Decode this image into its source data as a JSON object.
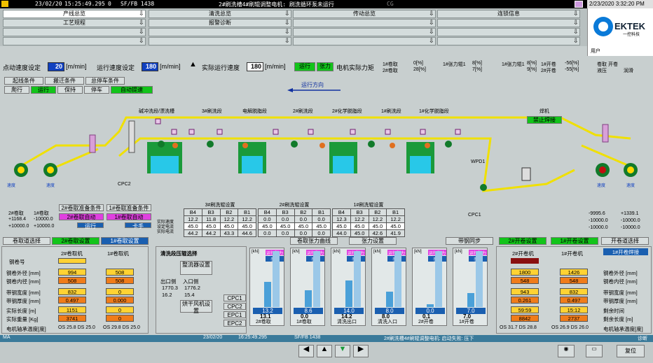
{
  "topbar": {
    "date": "23/02/20",
    "time": "15:25:49.295",
    "code": "0",
    "sf": "SF/FB 1438",
    "message": "2#刷洗槽4#刷辊调整电机: 刷洗循环泵未运行",
    "cg": "CG"
  },
  "clock": "2/23/2020 3:32:20 PM",
  "user": "用户",
  "logo": {
    "name": "EKTEK",
    "sub": "一控科技"
  },
  "menu": [
    [
      "产线总览",
      "清洗总览",
      "传动总览",
      "连锁信息"
    ],
    [
      "工艺规程",
      "报警诊断",
      "",
      ""
    ],
    [
      "",
      "",
      "",
      ""
    ],
    [
      "",
      "",
      "",
      ""
    ]
  ],
  "speed": {
    "set_label": "点动速度设定",
    "set_value": "20",
    "unit": "[m/min]",
    "run_label": "运行速度设定",
    "run_value": "180",
    "act_label": "实际运行速度",
    "act_value": "180",
    "run_btn": "运行",
    "tension_btn": "张力"
  },
  "torque": {
    "label": "电机实际力矩",
    "rows": [
      [
        "1#卷取",
        "0[%]",
        "2#卷取",
        "28[%]"
      ],
      [
        "1#张力辊1",
        "8[%]",
        "2",
        "7[%]"
      ],
      [
        "1#张力辊1",
        "8[%]",
        "2",
        "9[%]"
      ],
      [
        "1#开卷",
        "-56[%]",
        "2#开卷",
        "-55[%]"
      ]
    ],
    "coil_label": "卷取 开卷",
    "hydraulic": "液压",
    "lube": "润滑"
  },
  "status_btns": [
    "起线条件",
    "搬迁条件",
    "总停车条件",
    "爬行",
    "运行",
    "保持",
    "停车",
    "自动提速"
  ],
  "direction": "运行方向",
  "sections": [
    "碱冲洗段/漂洗槽",
    "3#刷洗段",
    "电解脱脂段",
    "2#刷洗段",
    "2#化学脱脂段",
    "1#刷洗段",
    "1#化学脱脂段"
  ],
  "labels": {
    "cpc2": "CPC2",
    "cpc1": "CPC1",
    "wpd1": "WPD1",
    "welder": "焊机",
    "weld_btn": "禁止焊接",
    "left1": "速度",
    "left2": "速度",
    "right1": "速度",
    "right2": "速度"
  },
  "brush_tables": [
    {
      "title": "3#刷洗辊设置",
      "cols": [
        "B4",
        "B3",
        "B2",
        "B1"
      ],
      "rows": [
        [
          "12.2",
          "11.8",
          "12.2",
          "12.2"
        ],
        [
          "45.0",
          "45.0",
          "45.0",
          "45.0"
        ],
        [
          "44.2",
          "44.2",
          "43.3",
          "44.6"
        ]
      ]
    },
    {
      "title": "2#刷洗辊设置",
      "cols": [
        "B4",
        "B3",
        "B2",
        "B1"
      ],
      "rows": [
        [
          "0.0",
          "0.0",
          "0.0",
          "0.0"
        ],
        [
          "45.0",
          "45.0",
          "45.0",
          "45.0"
        ],
        [
          "0.0",
          "0.0",
          "0.0",
          "0.0"
        ]
      ]
    },
    {
      "title": "1#刷洗辊设置",
      "cols": [
        "B4",
        "B3",
        "B2",
        "B1"
      ],
      "rows": [
        [
          "12.3",
          "12.2",
          "12.2",
          "12.2"
        ],
        [
          "45.0",
          "45.0",
          "45.0",
          "45.0"
        ],
        [
          "44.0",
          "45.0",
          "42.6",
          "41.9"
        ]
      ]
    }
  ],
  "row_labels": [
    "实际速度",
    "设定电流",
    "实际电流"
  ],
  "coil_left": {
    "label1": "2#卷取",
    "label2": "1#卷取",
    "v1": "+1168.4",
    "v2": "-10000.0",
    "v3": "+10000.0",
    "v4": "+10000.0"
  },
  "coil_right": {
    "v1": "-9995.6",
    "v2": "+1339.1",
    "v3": "-10000.0",
    "v4": "-10000.0",
    "v5": "-10000.0",
    "v6": "-10000.0"
  },
  "cond_left": [
    "2#卷取准备条件",
    "1#卷取准备条件",
    "2#卷取自动",
    "1#卷取自动",
    "运行",
    "卡手"
  ],
  "tabs": [
    "卷取道选择",
    "2#卷取设置",
    "1#卷取设置",
    "卷取张力曲线",
    "张力设置",
    "带钢同步",
    "2#开卷设置",
    "1#开卷设置",
    "开卷道选择"
  ],
  "left_panel": {
    "rows": [
      "钢卷外径 [mm]",
      "钢卷内径 [mm]",
      "带钢宽度 [mm]",
      "带钢厚度 [mm]",
      "实际长度 [m]",
      "实际重量 [Kg]",
      "电机轴承温度[度]"
    ],
    "c1": "2#卷取机",
    "c2": "1#卷取机",
    "v": [
      [
        "994",
        "508"
      ],
      [
        "508",
        "508"
      ],
      [
        "832",
        "0"
      ],
      [
        "0.497",
        "0.000"
      ],
      [
        "1151",
        "0"
      ],
      [
        "3741",
        "0"
      ]
    ],
    "os": [
      "OS 25.8 DS 25.0",
      "OS 29.8 DS 25.0"
    ],
    "coil_no": "钢卷号"
  },
  "clean_panel": {
    "title": "清洗段压辊选择",
    "btn1": "整流器设置",
    "out": "出口侧",
    "in": "入口侧",
    "v1": "1770.3",
    "v2": "1776.2",
    "v3": "16.2",
    "v4": "15.4",
    "btn2": "烘干风机设置",
    "cpc": [
      "CPC1",
      "CPC2",
      "EPC1",
      "EPC2"
    ]
  },
  "meters": [
    {
      "name": "2#卷取",
      "set": "13.2",
      "act": "13.1",
      "pct": 0.45
    },
    {
      "name": "1#卷取",
      "set": "8.6",
      "act": "0.0",
      "pct": 0.3
    },
    {
      "name": "清洗出口",
      "set": "14.0",
      "act": "14.2",
      "pct": 0.48
    },
    {
      "name": "清洗入口",
      "set": "8.0",
      "act": "8.0",
      "pct": 0.28
    },
    {
      "name": "2#开卷",
      "set": "0.0",
      "act": "0.1",
      "pct": 0.05
    },
    {
      "name": "1#开卷",
      "set": "7.0",
      "act": "7.0",
      "pct": 0.25
    }
  ],
  "meter_labels": {
    "unit": "[kN]",
    "tension": "运行张力",
    "manual": "手动"
  },
  "right_panel": {
    "c1": "2#开卷机",
    "c2": "1#开卷机",
    "c3": "1#开卷焊接",
    "rows": [
      "钢卷外径 [mm]",
      "钢卷内径 [mm]",
      "带钢宽度 [mm]",
      "带钢厚度 [mm]",
      "剩余时间",
      "剩余长度 [m]",
      "电机轴承温度[度]"
    ],
    "v": [
      [
        "1800",
        "1426"
      ],
      [
        "548",
        "548"
      ],
      [
        "943",
        "832"
      ],
      [
        "0.261",
        "0.497"
      ],
      [
        "59:59",
        "15:12"
      ],
      [
        "8842",
        "2737"
      ]
    ],
    "os": [
      "OS 31.7 DS 28.8",
      "OS 26.9 DS 26.0"
    ]
  },
  "statusbar": {
    "ma": "MA",
    "date": "23/02/20",
    "time": "16:25:49.295",
    "sf": "SF/FB 1438",
    "msg": "2#刷洗槽4#刷辊调整电机: 启动失败: 压下",
    "diag": "诊断"
  },
  "nav": {
    "reset": "复位"
  }
}
